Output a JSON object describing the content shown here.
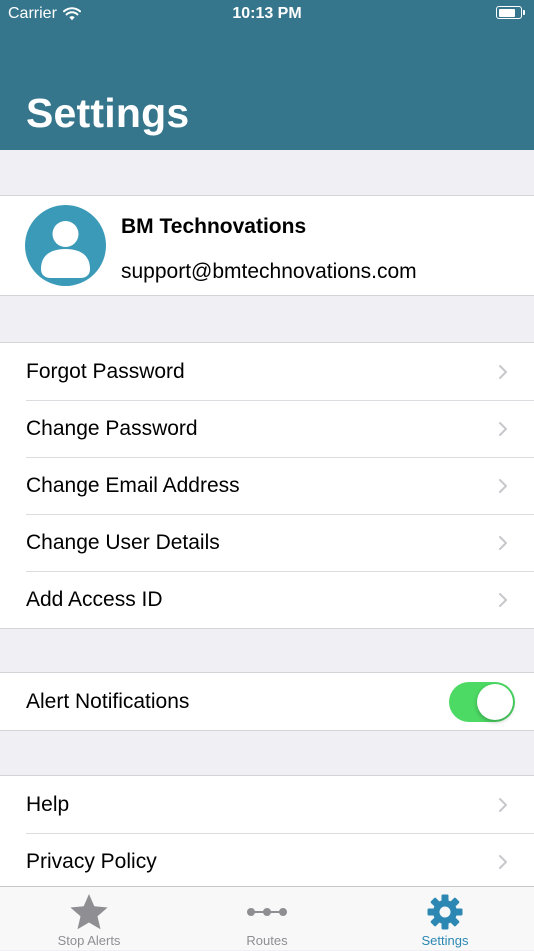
{
  "status_bar": {
    "carrier": "Carrier",
    "time": "10:13 PM"
  },
  "header": {
    "title": "Settings"
  },
  "profile": {
    "name": "BM Technovations",
    "email": "support@bmtechnovations.com"
  },
  "account_items": [
    {
      "label": "Forgot Password"
    },
    {
      "label": "Change Password"
    },
    {
      "label": "Change Email Address"
    },
    {
      "label": "Change User Details"
    },
    {
      "label": "Add Access ID"
    }
  ],
  "notifications": {
    "label": "Alert Notifications",
    "enabled": true
  },
  "info_items": [
    {
      "label": "Help"
    },
    {
      "label": "Privacy Policy"
    }
  ],
  "tab_bar": {
    "tabs": [
      {
        "label": "Stop Alerts",
        "icon": "star-icon",
        "active": false
      },
      {
        "label": "Routes",
        "icon": "route-icon",
        "active": false
      },
      {
        "label": "Settings",
        "icon": "gear-icon",
        "active": true
      }
    ]
  },
  "colors": {
    "header": "#36768c",
    "accent": "#2c88b3",
    "avatar": "#3a9ab7",
    "toggle_on": "#4cd964",
    "background": "#efeff4"
  }
}
